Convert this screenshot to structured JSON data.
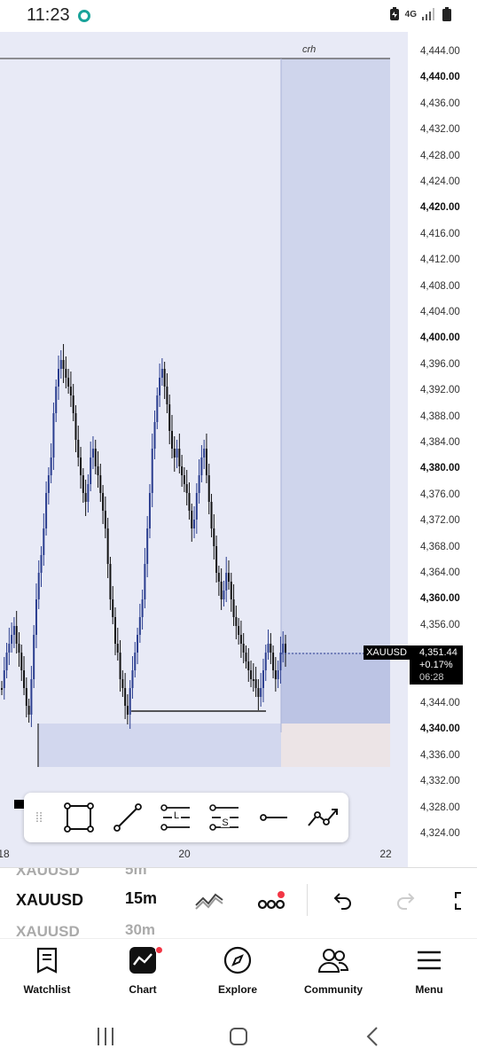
{
  "status_bar": {
    "time": "11:23",
    "network": "4G"
  },
  "chart": {
    "symbol": "XAUUSD",
    "zone_label": "crh",
    "price_axis": [
      {
        "label": "4,444.00",
        "value": 4444,
        "bold": false
      },
      {
        "label": "4,440.00",
        "value": 4440,
        "bold": true
      },
      {
        "label": "4,436.00",
        "value": 4436,
        "bold": false
      },
      {
        "label": "4,432.00",
        "value": 4432,
        "bold": false
      },
      {
        "label": "4,428.00",
        "value": 4428,
        "bold": false
      },
      {
        "label": "4,424.00",
        "value": 4424,
        "bold": false
      },
      {
        "label": "4,420.00",
        "value": 4420,
        "bold": true
      },
      {
        "label": "4,416.00",
        "value": 4416,
        "bold": false
      },
      {
        "label": "4,412.00",
        "value": 4412,
        "bold": false
      },
      {
        "label": "4,408.00",
        "value": 4408,
        "bold": false
      },
      {
        "label": "4,404.00",
        "value": 4404,
        "bold": false
      },
      {
        "label": "4,400.00",
        "value": 4400,
        "bold": true
      },
      {
        "label": "4,396.00",
        "value": 4396,
        "bold": false
      },
      {
        "label": "4,392.00",
        "value": 4392,
        "bold": false
      },
      {
        "label": "4,388.00",
        "value": 4388,
        "bold": false
      },
      {
        "label": "4,384.00",
        "value": 4384,
        "bold": false
      },
      {
        "label": "4,380.00",
        "value": 4380,
        "bold": true
      },
      {
        "label": "4,376.00",
        "value": 4376,
        "bold": false
      },
      {
        "label": "4,372.00",
        "value": 4372,
        "bold": false
      },
      {
        "label": "4,368.00",
        "value": 4368,
        "bold": false
      },
      {
        "label": "4,364.00",
        "value": 4364,
        "bold": false
      },
      {
        "label": "4,360.00",
        "value": 4360,
        "bold": true
      },
      {
        "label": "4,356.00",
        "value": 4356,
        "bold": false
      },
      {
        "label": "4,344.00",
        "value": 4344,
        "bold": false
      },
      {
        "label": "4,340.00",
        "value": 4340,
        "bold": true
      },
      {
        "label": "4,336.00",
        "value": 4336,
        "bold": false
      },
      {
        "label": "4,332.00",
        "value": 4332,
        "bold": false
      },
      {
        "label": "4,328.00",
        "value": 4328,
        "bold": false
      },
      {
        "label": "4,324.00",
        "value": 4324,
        "bold": false
      }
    ],
    "date_axis": [
      {
        "label": "18"
      },
      {
        "label": "20"
      },
      {
        "label": "22"
      }
    ],
    "current_price": {
      "price": "4,351.44",
      "change": "+0.17%",
      "countdown": "06:28"
    },
    "colors": {
      "background": "#e8eaf6",
      "zone": "#cfd5ec",
      "zone_lower": "#bcc4e4",
      "zone_red": "#ece4e6",
      "candle_up": "#2a3d8f",
      "candle_down": "#111111"
    }
  },
  "drawing_toolbar": {
    "tools": [
      {
        "icon": "rectangle-icon"
      },
      {
        "icon": "trend-line-icon"
      },
      {
        "icon": "long-position-icon",
        "letter": "L"
      },
      {
        "icon": "short-position-icon",
        "letter": "S"
      },
      {
        "icon": "horizontal-ray-icon"
      },
      {
        "icon": "path-icon"
      }
    ]
  },
  "symbol_bar": {
    "symbol": "XAUUSD",
    "symbol_prev": "XAUUSD",
    "symbol_next": "XAUUSD",
    "timeframe": "15m",
    "timeframe_prev": "5m",
    "timeframe_next": "30m"
  },
  "bottom_nav": [
    {
      "label": "Watchlist",
      "icon": "watchlist-icon"
    },
    {
      "label": "Chart",
      "icon": "chart-icon"
    },
    {
      "label": "Explore",
      "icon": "compass-icon"
    },
    {
      "label": "Community",
      "icon": "community-icon"
    },
    {
      "label": "Menu",
      "icon": "menu-icon"
    }
  ]
}
